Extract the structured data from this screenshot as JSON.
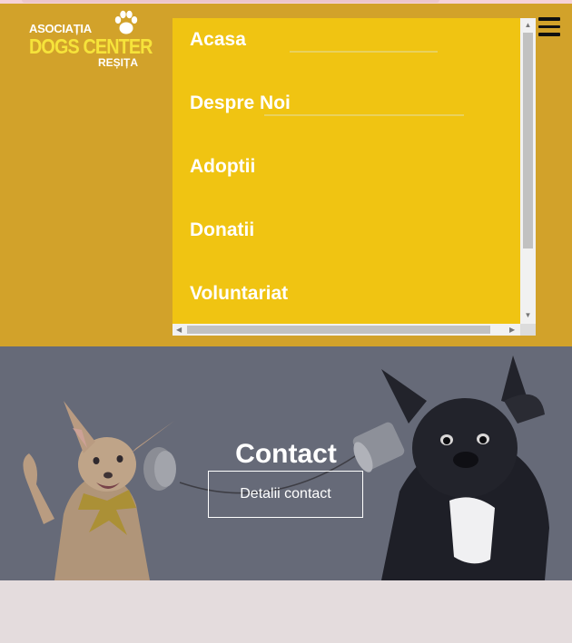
{
  "logo": {
    "line1": "ASOCIAȚIA",
    "line2": "DOGS CENTER",
    "line3": "REȘIȚA",
    "icon": "paw-print-icon"
  },
  "menu": {
    "items": [
      {
        "label": "Acasa"
      },
      {
        "label": "Despre Noi"
      },
      {
        "label": "Adoptii"
      },
      {
        "label": "Donatii"
      },
      {
        "label": "Voluntariat"
      }
    ]
  },
  "hero": {
    "title": "Contact",
    "button_label": "Detalii contact"
  },
  "colors": {
    "header_bg": "#d2a22a",
    "menu_bg": "#f0c412",
    "logo_accent": "#f6e33a",
    "hero_overlay": "#666a78"
  }
}
